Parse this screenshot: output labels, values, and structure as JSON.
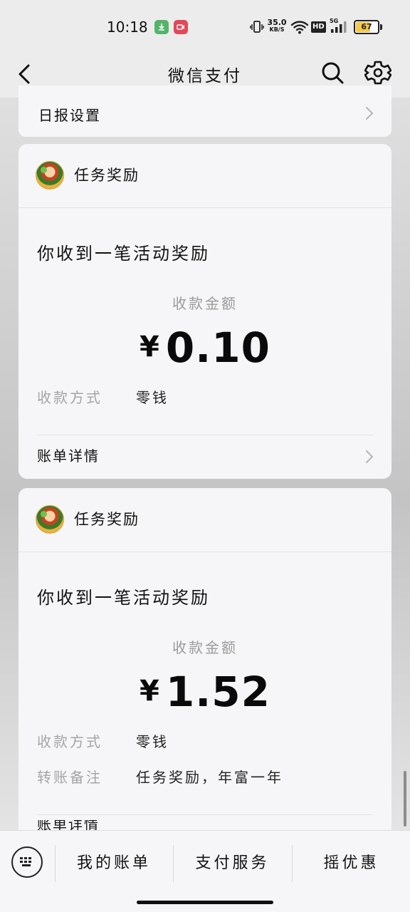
{
  "status_bar": {
    "time": "10:18",
    "net_speed": "35.0",
    "net_speed_unit": "KB/S",
    "hd_label": "HD",
    "signal_label": "5G",
    "battery": "67",
    "battery_level": 0.67
  },
  "nav": {
    "title": "微信支付"
  },
  "settings_row": {
    "label": "日报设置"
  },
  "messages": [
    {
      "sender": "任务奖励",
      "heading": "你收到一笔活动奖励",
      "amount_label": "收款金额",
      "currency": "¥",
      "amount": "0.10",
      "fields": [
        {
          "label": "收款方式",
          "value": "零钱"
        }
      ],
      "bill_details": "账单详情"
    },
    {
      "sender": "任务奖励",
      "heading": "你收到一笔活动奖励",
      "amount_label": "收款金额",
      "currency": "¥",
      "amount": "1.52",
      "fields": [
        {
          "label": "收款方式",
          "value": "零钱"
        },
        {
          "label": "转账备注",
          "value": "任务奖励，年富一年"
        }
      ],
      "bill_details": "账单详情"
    }
  ],
  "bottom_menu": {
    "items": [
      "我的账单",
      "支付服务",
      "摇优惠"
    ]
  },
  "icons": {
    "back": "chevron-left-icon",
    "search": "search-icon",
    "settings": "gear-icon",
    "keyboard": "keyboard-icon",
    "row_chevron": "chevron-right-icon"
  }
}
